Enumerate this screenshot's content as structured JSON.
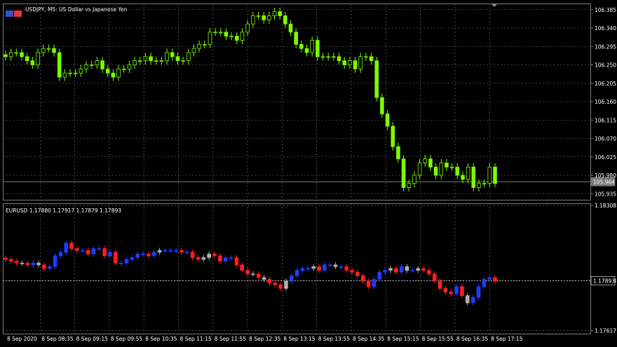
{
  "window": {
    "upper_title": "USDJPY, M5:  US Dollar vs Japanese Yen",
    "lower_title": "EURUSD 1.17880 1.17917 1.17879 1.17893"
  },
  "colors": {
    "background": "#000000",
    "grid": "#7a7a7a",
    "upper_candle": "#7CFC00",
    "eurusd_up": "#1f3cff",
    "eurusd_down": "#ff1f1f",
    "eurusd_doji": "#b0b0b0",
    "price_tag": "#7a7a7a"
  },
  "chart_data": [
    {
      "type": "candlestick",
      "symbol": "USDJPY",
      "yticks": [
        "106.385",
        "106.340",
        "106.295",
        "106.250",
        "106.205",
        "106.160",
        "106.115",
        "106.070",
        "106.025",
        "105.980",
        "105.935"
      ],
      "current_price": "105.964",
      "ylim": [
        105.92,
        106.4
      ],
      "close": [
        106.27,
        106.28,
        106.28,
        106.27,
        106.26,
        106.25,
        106.28,
        106.29,
        106.29,
        106.28,
        106.22,
        106.23,
        106.23,
        106.23,
        106.24,
        106.25,
        106.25,
        106.26,
        106.24,
        106.23,
        106.22,
        106.24,
        106.24,
        106.25,
        106.26,
        106.26,
        106.27,
        106.26,
        106.26,
        106.26,
        106.28,
        106.27,
        106.26,
        106.26,
        106.28,
        106.29,
        106.3,
        106.3,
        106.33,
        106.33,
        106.33,
        106.32,
        106.32,
        106.31,
        106.33,
        106.35,
        106.37,
        106.37,
        106.36,
        106.37,
        106.38,
        106.37,
        106.35,
        106.33,
        106.3,
        106.29,
        106.28,
        106.31,
        106.27,
        106.27,
        106.27,
        106.27,
        106.26,
        106.25,
        106.26,
        106.24,
        106.27,
        106.27,
        106.26,
        106.17,
        106.13,
        106.1,
        106.05,
        106.02,
        105.95,
        105.96,
        105.98,
        106.01,
        106.02,
        106.0,
        105.98,
        106.01,
        106.0,
        106.0,
        105.98,
        105.97,
        106.0,
        105.95,
        105.96,
        105.96,
        106.0,
        105.96
      ]
    },
    {
      "type": "candlestick",
      "symbol": "EURUSD",
      "yticks": [
        "1.18308",
        "1.17893",
        "1.17617"
      ],
      "current_price": "1.17893",
      "ylim": [
        1.176,
        1.1832
      ],
      "close": [
        1.1801,
        1.18,
        1.1799,
        1.1799,
        1.1798,
        1.1799,
        1.1798,
        1.1796,
        1.1797,
        1.1803,
        1.1805,
        1.181,
        1.1807,
        1.1806,
        1.1806,
        1.1804,
        1.1807,
        1.1807,
        1.1803,
        1.1805,
        1.1799,
        1.1799,
        1.1801,
        1.1802,
        1.1804,
        1.1804,
        1.1803,
        1.1805,
        1.1806,
        1.1806,
        1.1806,
        1.1806,
        1.1805,
        1.1805,
        1.1802,
        1.1801,
        1.1802,
        1.1804,
        1.1803,
        1.18,
        1.1802,
        1.1802,
        1.1798,
        1.1795,
        1.1793,
        1.1793,
        1.1791,
        1.179,
        1.1788,
        1.1787,
        1.1785,
        1.1789,
        1.1792,
        1.1795,
        1.1796,
        1.1796,
        1.1797,
        1.1795,
        1.1798,
        1.1798,
        1.1797,
        1.1797,
        1.1795,
        1.1794,
        1.1792,
        1.1789,
        1.1786,
        1.179,
        1.1794,
        1.1795,
        1.1796,
        1.1794,
        1.1797,
        1.1795,
        1.1795,
        1.1796,
        1.1795,
        1.1793,
        1.1789,
        1.1785,
        1.1783,
        1.1782,
        1.1786,
        1.1781,
        1.1777,
        1.178,
        1.1786,
        1.179,
        1.1791,
        1.1789
      ],
      "dojis": [
        3,
        6,
        28,
        36,
        37,
        45,
        47,
        51,
        56,
        60,
        70,
        73,
        75,
        84
      ]
    }
  ],
  "xaxis": {
    "labels": [
      "8 Sep 2020",
      "8 Sep 08:35",
      "8 Sep 09:15",
      "8 Sep 09:55",
      "8 Sep 10:35",
      "8 Sep 11:15",
      "8 Sep 11:55",
      "8 Sep 12:35",
      "8 Sep 13:15",
      "8 Sep 13:55",
      "8 Sep 14:35",
      "8 Sep 15:15",
      "8 Sep 15:55",
      "8 Sep 16:35",
      "8 Sep 17:15"
    ]
  }
}
